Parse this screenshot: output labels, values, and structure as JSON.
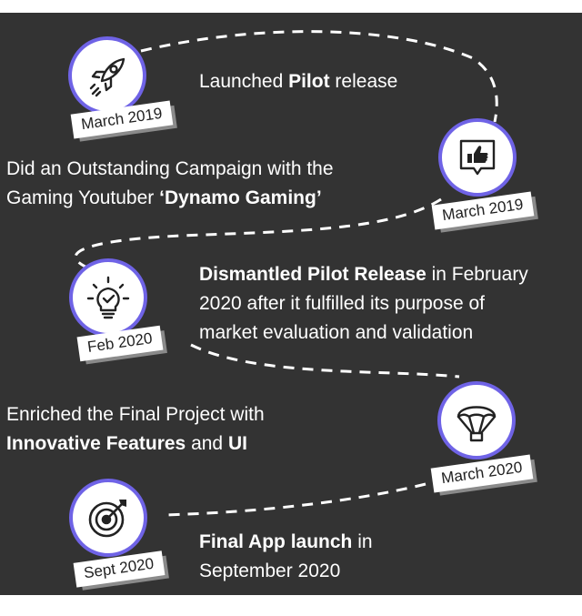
{
  "milestones": [
    {
      "date": "March 2019",
      "icon": "rocket-icon",
      "text_pre": "Launched ",
      "text_bold": "Pilot",
      "text_post": " release"
    },
    {
      "date": "March 2019",
      "icon": "thumbs-up-icon",
      "line1": "Did an Outstanding Campaign with the",
      "line2_pre": "Gaming Youtuber ",
      "line2_bold": "‘Dynamo Gaming’"
    },
    {
      "date": "Feb 2020",
      "icon": "lightbulb-icon",
      "text_bold": "Dismantled Pilot Release",
      "text_post": " in February",
      "line2": "2020 after it fulfilled its purpose of",
      "line3": "market evaluation and validation"
    },
    {
      "date": "March 2020",
      "icon": "parachute-icon",
      "line1": "Enriched the Final Project with",
      "line2_bold1": "Innovative Features",
      "line2_mid": " and ",
      "line2_bold2": "UI"
    },
    {
      "date": "Sept 2020",
      "icon": "target-icon",
      "text_bold": "Final App launch",
      "text_post": " in",
      "line2": "September 2020"
    }
  ],
  "colors": {
    "background": "#333333",
    "ring": "#6f63e6",
    "text": "#ffffff",
    "badge": "#ffffff"
  }
}
